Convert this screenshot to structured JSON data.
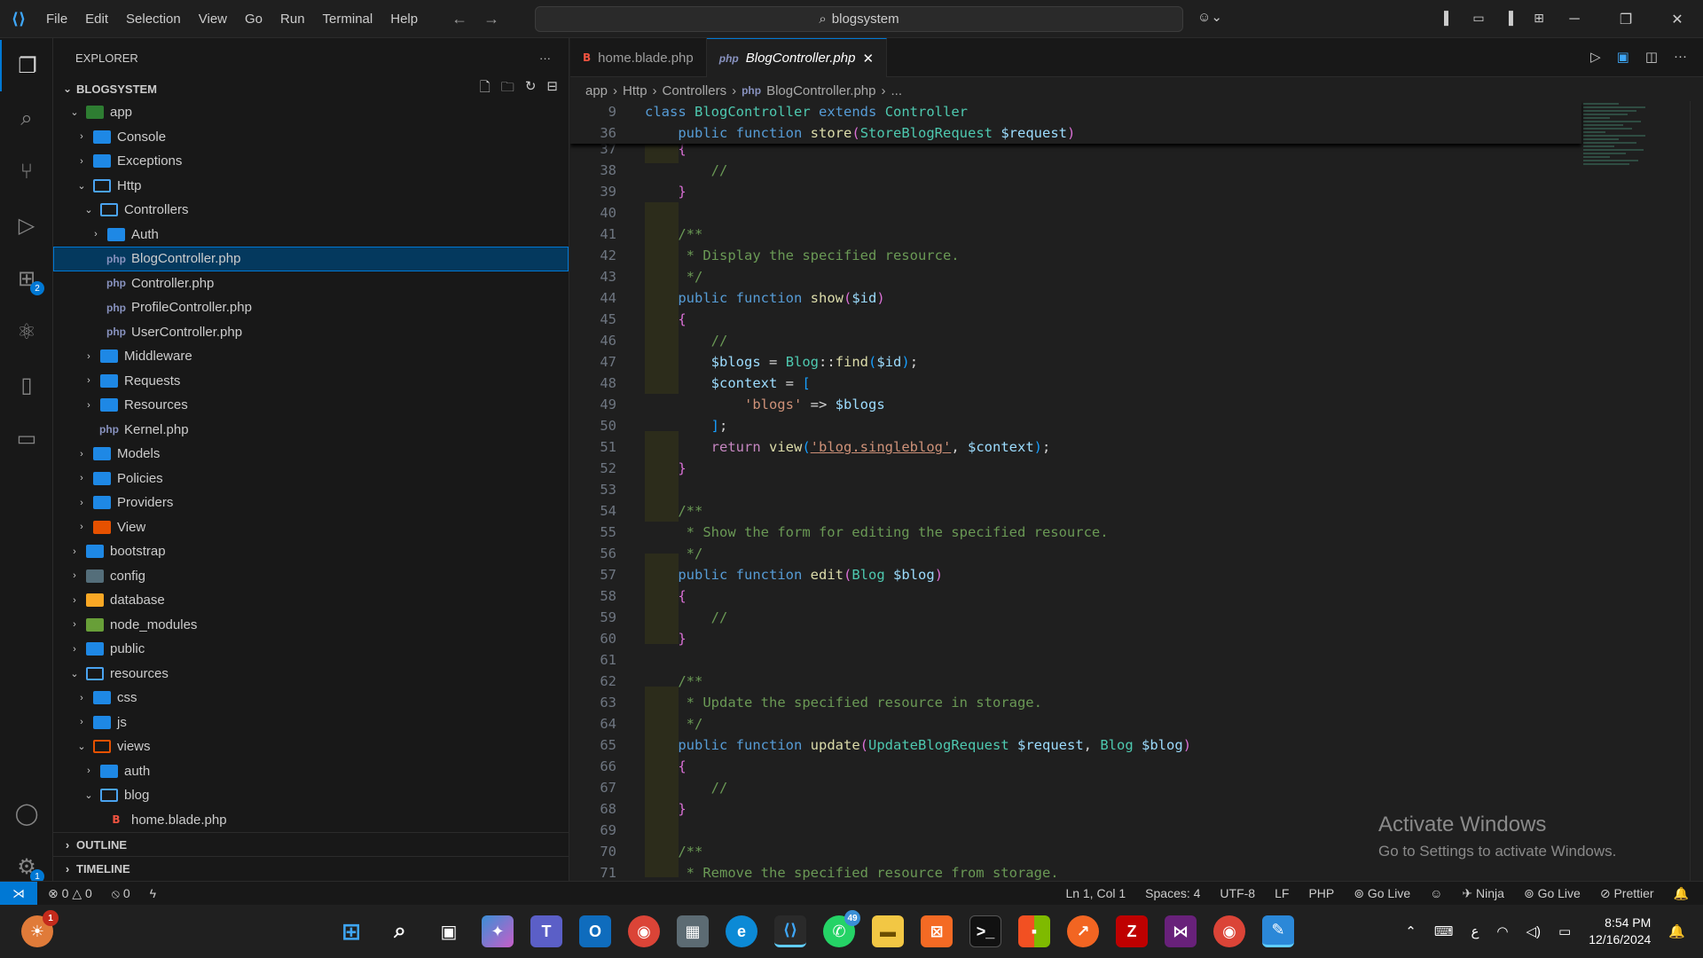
{
  "menu": [
    "File",
    "Edit",
    "Selection",
    "View",
    "Go",
    "Run",
    "Terminal",
    "Help"
  ],
  "search": {
    "text": "blogsystem"
  },
  "explorer": {
    "title": "EXPLORER",
    "more": "···",
    "root": "BLOGSYSTEM",
    "tree": [
      {
        "label": "app",
        "chev": "⌄",
        "depth": 1,
        "icon": "app"
      },
      {
        "label": "Console",
        "chev": "›",
        "depth": 2,
        "icon": "folder"
      },
      {
        "label": "Exceptions",
        "chev": "›",
        "depth": 2,
        "icon": "folder"
      },
      {
        "label": "Http",
        "chev": "⌄",
        "depth": 2,
        "icon": "open"
      },
      {
        "label": "Controllers",
        "chev": "⌄",
        "depth": 3,
        "icon": "open"
      },
      {
        "label": "Auth",
        "chev": "›",
        "depth": 4,
        "icon": "folder"
      },
      {
        "label": "BlogController.php",
        "chev": "",
        "depth": 4,
        "icon": "php",
        "selected": true
      },
      {
        "label": "Controller.php",
        "chev": "",
        "depth": 4,
        "icon": "php"
      },
      {
        "label": "ProfileController.php",
        "chev": "",
        "depth": 4,
        "icon": "php"
      },
      {
        "label": "UserController.php",
        "chev": "",
        "depth": 4,
        "icon": "php"
      },
      {
        "label": "Middleware",
        "chev": "›",
        "depth": 3,
        "icon": "folder"
      },
      {
        "label": "Requests",
        "chev": "›",
        "depth": 3,
        "icon": "folder"
      },
      {
        "label": "Resources",
        "chev": "›",
        "depth": 3,
        "icon": "folder"
      },
      {
        "label": "Kernel.php",
        "chev": "",
        "depth": 3,
        "icon": "php"
      },
      {
        "label": "Models",
        "chev": "›",
        "depth": 2,
        "icon": "folder"
      },
      {
        "label": "Policies",
        "chev": "›",
        "depth": 2,
        "icon": "folder"
      },
      {
        "label": "Providers",
        "chev": "›",
        "depth": 2,
        "icon": "folder"
      },
      {
        "label": "View",
        "chev": "›",
        "depth": 2,
        "icon": "view"
      },
      {
        "label": "bootstrap",
        "chev": "›",
        "depth": 1,
        "icon": "folder"
      },
      {
        "label": "config",
        "chev": "›",
        "depth": 1,
        "icon": "conf"
      },
      {
        "label": "database",
        "chev": "›",
        "depth": 1,
        "icon": "db"
      },
      {
        "label": "node_modules",
        "chev": "›",
        "depth": 1,
        "icon": "node"
      },
      {
        "label": "public",
        "chev": "›",
        "depth": 1,
        "icon": "folder"
      },
      {
        "label": "resources",
        "chev": "⌄",
        "depth": 1,
        "icon": "open"
      },
      {
        "label": "css",
        "chev": "›",
        "depth": 2,
        "icon": "folder"
      },
      {
        "label": "js",
        "chev": "›",
        "depth": 2,
        "icon": "folder"
      },
      {
        "label": "views",
        "chev": "⌄",
        "depth": 2,
        "icon": "views"
      },
      {
        "label": "auth",
        "chev": "›",
        "depth": 3,
        "icon": "folder"
      },
      {
        "label": "blog",
        "chev": "⌄",
        "depth": 3,
        "icon": "open"
      },
      {
        "label": "home.blade.php",
        "chev": "",
        "depth": 4,
        "icon": "blade"
      }
    ],
    "outline": "OUTLINE",
    "timeline": "TIMELINE"
  },
  "tabs": [
    {
      "label": "home.blade.php",
      "active": false
    },
    {
      "label": "BlogController.php",
      "active": true
    }
  ],
  "breadcrumb": [
    "app",
    "Http",
    "Controllers",
    "BlogController.php",
    "..."
  ],
  "activation": {
    "title": "Activate Windows",
    "subtitle": "Go to Settings to activate Windows."
  },
  "status": {
    "errors": "0",
    "warnings": "0",
    "ports": "0",
    "position": "Ln 1, Col 1",
    "spaces": "Spaces: 4",
    "encoding": "UTF-8",
    "eol": "LF",
    "language": "PHP",
    "golive1": "Go Live",
    "ninja": "Ninja",
    "golive2": "Go Live",
    "prettier": "Prettier"
  },
  "taskbar": {
    "time": "8:54 PM",
    "date": "12/16/2024",
    "lang": "ع",
    "badge_teams": "1",
    "badge_whatsapp": "49"
  },
  "activity_badges": {
    "extensions": "2",
    "settings": "1"
  },
  "colors": {
    "accent": "#0078d4",
    "keyword": "#569cd6",
    "function": "#dcdcaa",
    "class": "#4ec9b0",
    "variable": "#9cdcfe",
    "comment": "#6a9955",
    "string": "#ce9178"
  }
}
